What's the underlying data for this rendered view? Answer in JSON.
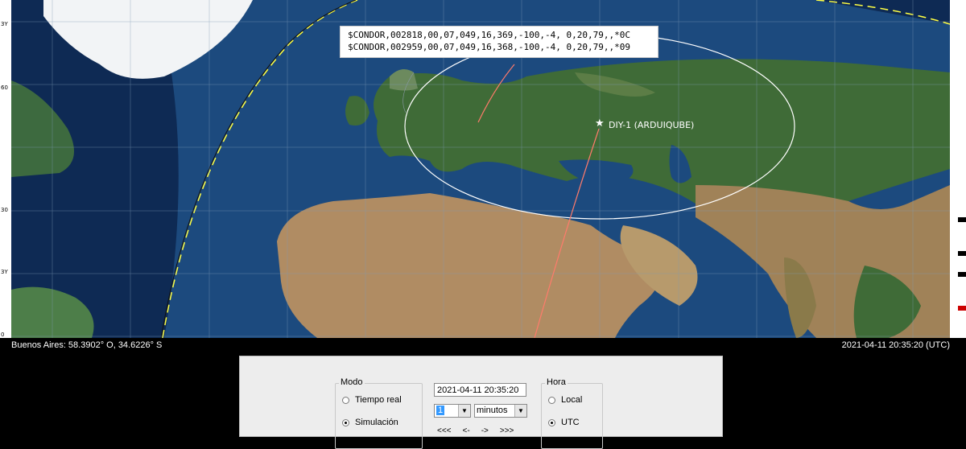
{
  "map": {
    "lat_ticks": [
      "3Y",
      "60",
      "30",
      "3Y",
      "0"
    ],
    "nmea_lines": [
      "$CONDOR,002818,00,07,049,16,369,-100,-4, 0,20,79,,*0C",
      "$CONDOR,002959,00,07,049,16,368,-100,-4, 0,20,79,,*09"
    ],
    "satellite_name": "DIY-1 (ARDUIQUBE)",
    "colors": {
      "track": "#ff7b6b",
      "footprint": "#ffffff",
      "terminator_day": "#ffff44",
      "terminator_night": "#111111"
    }
  },
  "status": {
    "location": "Buenos Aires: 58.3902° O, 34.6226° S",
    "datetime": "2021-04-11 20:35:20 (UTC)"
  },
  "controls": {
    "modo_title": "Modo",
    "tiempo_real_label": "Tiempo real",
    "simulacion_label": "Simulación",
    "modo_selected": "Simulación",
    "datetime_value": "2021-04-11 20:35:20",
    "step_value": "1",
    "unit_value": "minutos",
    "nav": [
      "<<<",
      "<-",
      "->",
      ">>>"
    ],
    "hora_title": "Hora",
    "local_label": "Local",
    "utc_label": "UTC",
    "hora_selected": "UTC"
  }
}
